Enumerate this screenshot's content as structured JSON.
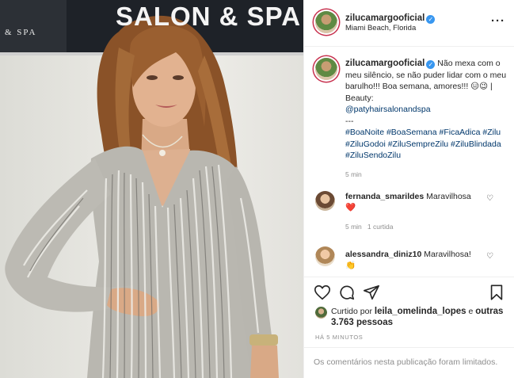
{
  "photo": {
    "sign_text": "SALON & SPA",
    "sign_small_text": "& SPA"
  },
  "header": {
    "username": "zilucamargooficial",
    "location": "Miami Beach, Florida",
    "more_icon": "ellipsis-icon"
  },
  "caption": {
    "username": "zilucamargooficial",
    "text": "Não mexa com o meu silêncio, se não puder lidar com o meu barulho!!! Boa semana, amores!!! 😑😉 | Beauty:",
    "mention": "@patyhairsalonandspa",
    "separator": "---",
    "hashtags": "#BoaNoite #BoaSemana #FicaAdica #Zilu #ZiluGodoi #ZiluSempreZilu #ZiluBlindada #ZiluSendoZilu",
    "time": "5 min"
  },
  "comments": [
    {
      "username": "fernanda_smarildes",
      "text": "Maravilhosa",
      "emoji": "❤️",
      "time": "5 min",
      "replies": "1 curtida"
    },
    {
      "username": "alessandra_diniz10",
      "text": "Maravilhosa!",
      "emoji": "👏"
    }
  ],
  "actions": {
    "icons": [
      "heart-icon",
      "comment-icon",
      "share-icon",
      "bookmark-icon"
    ]
  },
  "likes": {
    "prefix": "Curtido por",
    "user": "leila_omelinda_lopes",
    "middle": "e",
    "others": "outras 3.763 pessoas"
  },
  "posted_ago": "HÁ 5 MINUTOS",
  "comments_limited": "Os comentários nesta publicação foram limitados.",
  "colors": {
    "accent": "#3897f0",
    "link": "#00376b",
    "muted": "#8e8e8e",
    "ring": "#c8324f"
  }
}
